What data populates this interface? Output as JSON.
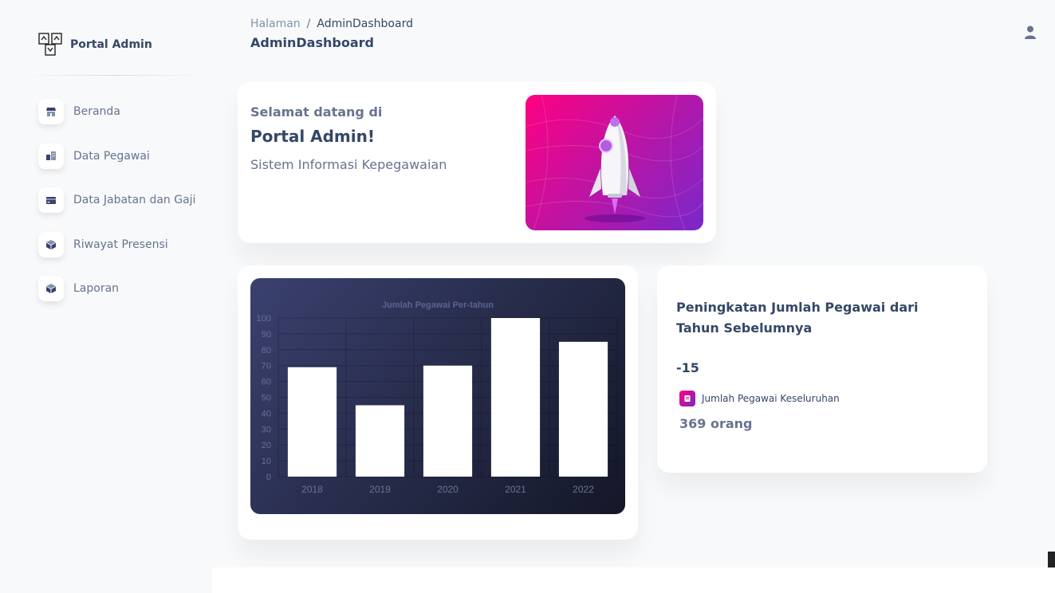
{
  "sidebar": {
    "brand": {
      "name": "Portal Admin",
      "icon": "logo-icon"
    },
    "items": [
      {
        "label": "Beranda",
        "icon": "shop-icon"
      },
      {
        "label": "Data Pegawai",
        "icon": "office-icon"
      },
      {
        "label": "Data Jabatan dan Gaji",
        "icon": "credit-card-icon"
      },
      {
        "label": "Riwayat Presensi",
        "icon": "box-icon"
      },
      {
        "label": "Laporan",
        "icon": "box-icon"
      }
    ]
  },
  "header": {
    "breadcrumb": {
      "home": "Halaman",
      "separator": "/",
      "current": "AdminDashboard"
    },
    "title": "AdminDashboard",
    "user_icon": "user-icon"
  },
  "welcome": {
    "subtitle": "Selamat datang di",
    "title": "Portal Admin!",
    "description": "Sistem Informasi Kepegawaian",
    "image": "rocket-illustration"
  },
  "chart_data": {
    "type": "bar",
    "title": "Jumlah Pegawai Per-tahun",
    "categories": [
      "2018",
      "2019",
      "2020",
      "2021",
      "2022"
    ],
    "values": [
      69,
      45,
      70,
      100,
      85
    ],
    "ylim": [
      0,
      100
    ],
    "yticks": [
      0,
      10,
      20,
      30,
      40,
      50,
      60,
      70,
      80,
      90,
      100
    ],
    "grid": true,
    "bar_color": "#ffffff",
    "xlabel": "",
    "ylabel": ""
  },
  "stats": {
    "title": "Peningkatan Jumlah Pegawai dari Tahun Sebelumnya",
    "value": "-15",
    "sub_label": "Jumlah Pegawai Keseluruhan",
    "sub_icon": "document-icon",
    "total": "369 orang"
  },
  "colors": {
    "primary_gradient_start": "#ff0080",
    "primary_gradient_end": "#7928ca",
    "dark_gradient_start": "#3a416f",
    "dark_gradient_end": "#141727",
    "text_heading": "#344767",
    "text_body": "#67748e"
  }
}
